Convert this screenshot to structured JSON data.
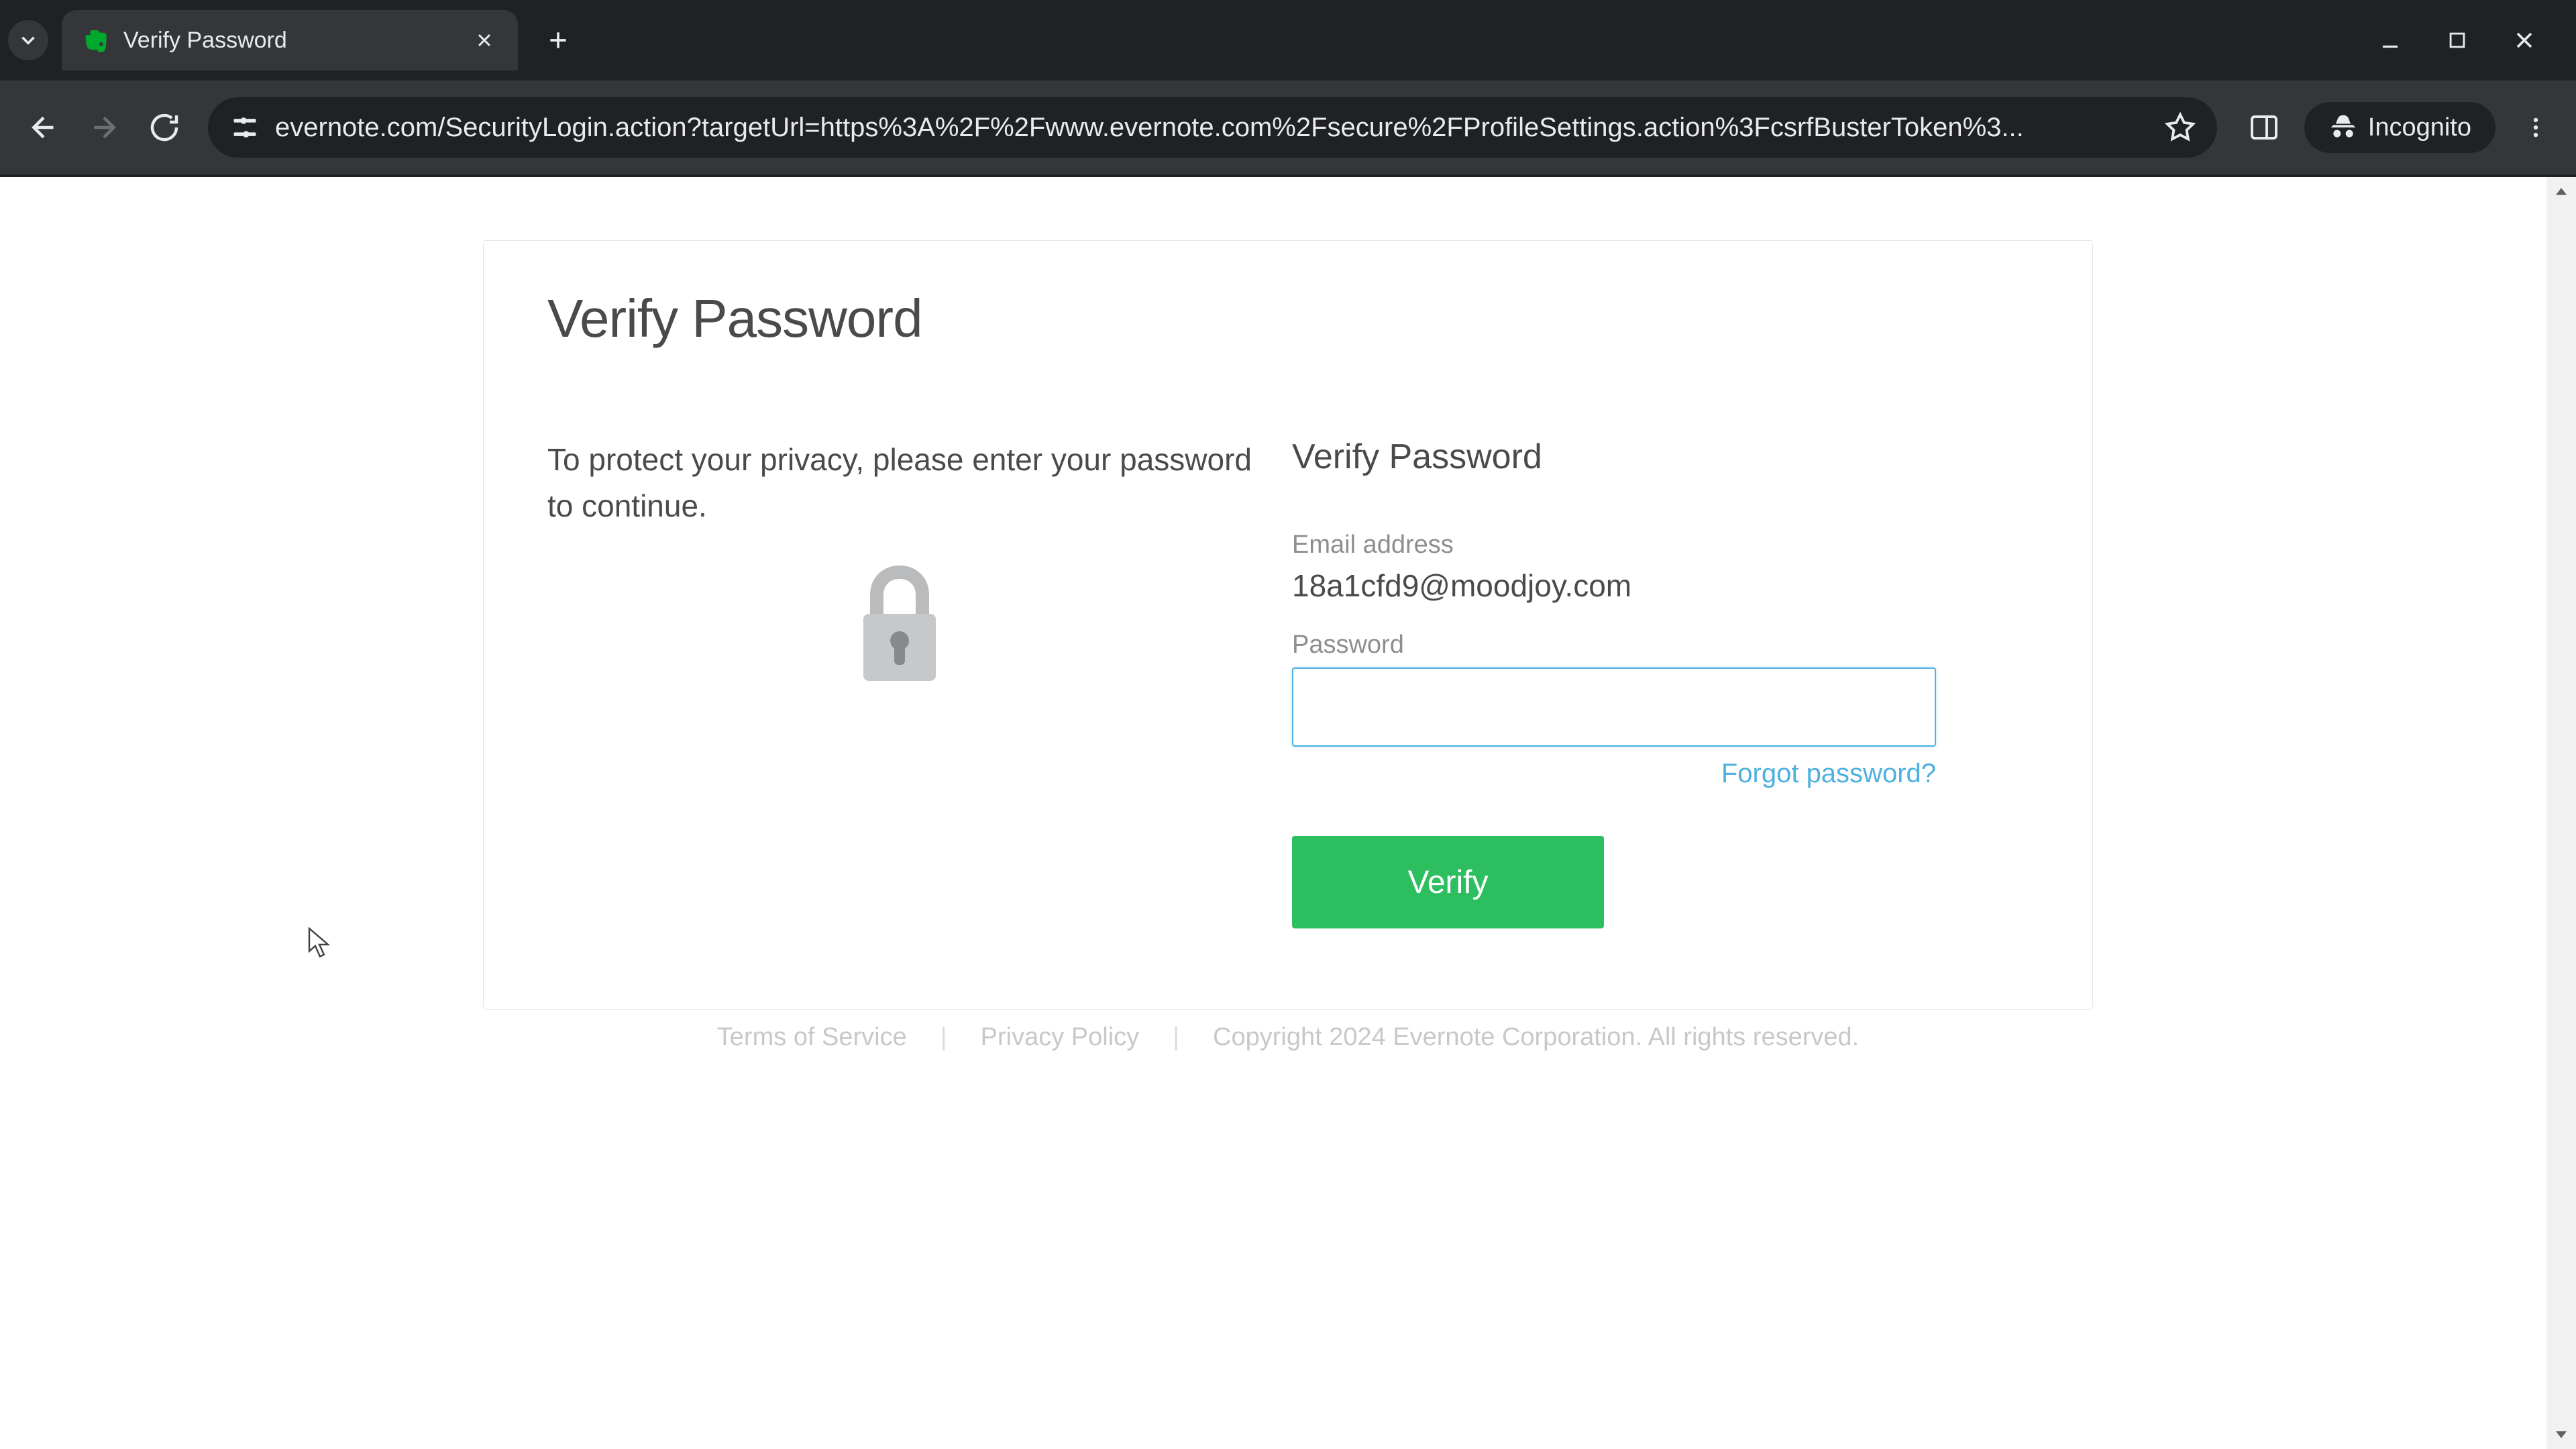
{
  "browser": {
    "tab_title": "Verify Password",
    "url": "evernote.com/SecurityLogin.action?targetUrl=https%3A%2F%2Fwww.evernote.com%2Fsecure%2FProfileSettings.action%3FcsrfBusterToken%3...",
    "incognito_label": "Incognito"
  },
  "page": {
    "heading": "Verify Password",
    "privacy_text": "To protect your privacy, please enter your password to continue.",
    "form_heading": "Verify Password",
    "email_label": "Email address",
    "email_value": "18a1cfd9@moodjoy.com",
    "password_label": "Password",
    "password_value": "",
    "forgot_link": "Forgot password?",
    "verify_button": "Verify"
  },
  "footer": {
    "terms": "Terms of Service",
    "privacy": "Privacy Policy",
    "copyright": "Copyright 2024 Evernote Corporation. All rights reserved."
  }
}
